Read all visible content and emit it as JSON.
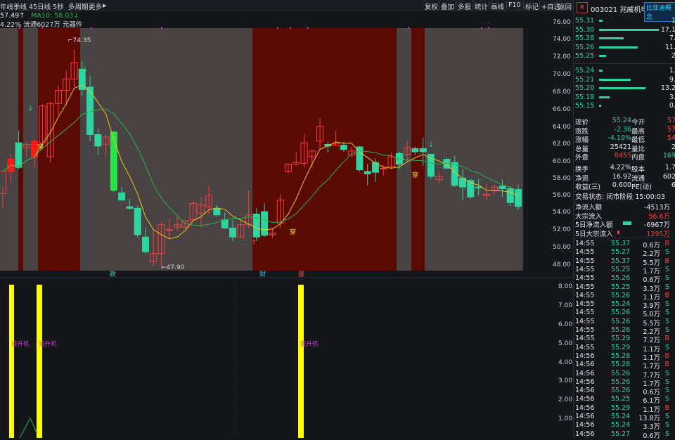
{
  "toolbar": {
    "left_items": [
      "年线",
      "季线",
      "45日线",
      "5秒",
      "多周期",
      "更多"
    ],
    "right_items": [
      "复权",
      "叠加",
      "多股",
      "统计",
      "画线",
      "F10",
      "标记",
      "+自选",
      "返回"
    ]
  },
  "indicators": {
    "ma5_label": "57.49↑",
    "ma10_label": "MA10: 58.03↓",
    "info": "4.22% 流通6027万 元器件"
  },
  "chart_labels": {
    "high_label": "74.35",
    "low_label": "47.90",
    "signal_chuan": "穿",
    "event_die": "跌",
    "event_cai": "财",
    "event_zhang": "涨",
    "sub_label": "资升机"
  },
  "price_axis": [
    "76.00",
    "74.00",
    "72.00",
    "70.00",
    "68.00",
    "66.00",
    "64.00",
    "62.00",
    "60.00",
    "58.00",
    "56.00",
    "54.00",
    "52.00",
    "50.00",
    "48.00"
  ],
  "sub_axis": [
    "8.00",
    "7.00",
    "6.00",
    "5.00",
    "4.00",
    "3.00",
    "2.00",
    "1.00"
  ],
  "stock": {
    "logo": "R",
    "code": "003021",
    "name": "兆威机电",
    "sub_tag": "比亚迪概念"
  },
  "asks": [
    {
      "price": "55.31",
      "vol": "1"
    },
    {
      "price": "55.30",
      "vol": "17.1"
    },
    {
      "price": "55.28",
      "vol": "7."
    },
    {
      "price": "55.26",
      "vol": "11."
    },
    {
      "price": "55.25",
      "vol": "2"
    }
  ],
  "bids": [
    {
      "price": "55.24",
      "vol": "1."
    },
    {
      "price": "55.21",
      "vol": "9."
    },
    {
      "price": "55.20",
      "vol": "13.2"
    },
    {
      "price": "55.18",
      "vol": "3."
    },
    {
      "price": "55.15",
      "vol": "0."
    }
  ],
  "quote": [
    {
      "l1": "现价",
      "v1": "55.24",
      "l2": "今开",
      "v2": "57"
    },
    {
      "l1": "涨跌",
      "v1": "-2.36",
      "l2": "最高",
      "v2": "57"
    },
    {
      "l1": "涨幅",
      "v1": "-4.10%",
      "l2": "最低",
      "v2": "54"
    },
    {
      "l1": "总量",
      "v1": "25421",
      "l2": "量比",
      "v2": "2"
    },
    {
      "l1": "外盘",
      "v1": "8455",
      "l2": "内盘",
      "v2": "169"
    }
  ],
  "quote2": [
    {
      "l1": "换手",
      "v1": "4.22%",
      "l2": "股本",
      "v2": "1.7"
    },
    {
      "l1": "净资",
      "v1": "16.92",
      "l2": "流通",
      "v2": "602"
    },
    {
      "l1": "收益(三)",
      "v1": "0.600",
      "l2": "PE(动)",
      "v2": "6"
    }
  ],
  "trade_state": "交易状态: 闭市阶段 15:00:03",
  "flows": [
    {
      "label": "净流入额",
      "value": "-4513万"
    },
    {
      "label": "大宗流入",
      "value": "56.6万"
    },
    {
      "label": "5日净流入额",
      "value": "-6967万"
    },
    {
      "label": "5日大宗流入",
      "value": "1295万"
    }
  ],
  "ticks": [
    {
      "t": "14:55",
      "p": "55.37",
      "v": "0.6万",
      "s": "B"
    },
    {
      "t": "14:55",
      "p": "55.27",
      "v": "2.2万",
      "s": "S"
    },
    {
      "t": "14:55",
      "p": "55.37",
      "v": "5.5万",
      "s": "B"
    },
    {
      "t": "14:55",
      "p": "55.25",
      "v": "1.7万",
      "s": "S"
    },
    {
      "t": "14:55",
      "p": "55.26",
      "v": "0.6万",
      "s": "S"
    },
    {
      "t": "14:55",
      "p": "55.25",
      "v": "3.3万",
      "s": "S"
    },
    {
      "t": "14:55",
      "p": "55.26",
      "v": "1.1万",
      "s": "B"
    },
    {
      "t": "14:55",
      "p": "55.24",
      "v": "3.9万",
      "s": "S"
    },
    {
      "t": "14:55",
      "p": "55.26",
      "v": "5.0万",
      "s": "S"
    },
    {
      "t": "14:55",
      "p": "55.26",
      "v": "5.5万",
      "s": "S"
    },
    {
      "t": "14:55",
      "p": "55.26",
      "v": "2.2万",
      "s": "S"
    },
    {
      "t": "14:55",
      "p": "55.29",
      "v": "7.2万",
      "s": "B"
    },
    {
      "t": "14:55",
      "p": "55.29",
      "v": "1.1万",
      "s": "S"
    },
    {
      "t": "14:56",
      "p": "55.28",
      "v": "1.1万",
      "s": "B"
    },
    {
      "t": "14:56",
      "p": "55.28",
      "v": "1.7万",
      "s": "B"
    },
    {
      "t": "14:56",
      "p": "55.26",
      "v": "7.7万",
      "s": "S"
    },
    {
      "t": "14:56",
      "p": "55.26",
      "v": "1.7万",
      "s": "S"
    },
    {
      "t": "14:56",
      "p": "55.26",
      "v": "0.6万",
      "s": "S"
    },
    {
      "t": "14:56",
      "p": "55.25",
      "v": "6.1万",
      "s": "S"
    },
    {
      "t": "14:56",
      "p": "55.29",
      "v": "1.1万",
      "s": "B"
    },
    {
      "t": "14:56",
      "p": "55.24",
      "v": "13.8万",
      "s": "S"
    },
    {
      "t": "14:56",
      "p": "55.24",
      "v": "3.3万",
      "s": "S"
    },
    {
      "t": "14:56",
      "p": "55.27",
      "v": "0.6万",
      "s": "S"
    }
  ],
  "candles": [
    {
      "o": 56.8,
      "h": 57.6,
      "l": 55.0,
      "c": 59.5
    },
    {
      "o": 59.5,
      "h": 61.7,
      "l": 58.2,
      "c": 61.0
    },
    {
      "o": 63.0,
      "h": 64.5,
      "l": 59.8,
      "c": 60.0
    },
    {
      "o": 62.4,
      "h": 63.1,
      "l": 61.4,
      "c": 62.8
    },
    {
      "o": 61.2,
      "h": 63.4,
      "l": 60.0,
      "c": 63.2
    },
    {
      "o": 63.0,
      "h": 67.7,
      "l": 62.2,
      "c": 67.5
    },
    {
      "o": 61.3,
      "h": 68.0,
      "l": 60.6,
      "c": 67.8
    },
    {
      "o": 67.8,
      "h": 70.0,
      "l": 66.4,
      "c": 69.4
    },
    {
      "o": 69.4,
      "h": 71.8,
      "l": 67.6,
      "c": 70.8
    },
    {
      "o": 70.8,
      "h": 74.35,
      "l": 69.8,
      "c": 72.8
    },
    {
      "o": 72.0,
      "h": 73.0,
      "l": 68.7,
      "c": 69.5
    },
    {
      "o": 69.8,
      "h": 71.2,
      "l": 63.2,
      "c": 64.0
    },
    {
      "o": 64.0,
      "h": 64.8,
      "l": 61.5,
      "c": 62.6
    },
    {
      "o": 62.8,
      "h": 64.0,
      "l": 61.5,
      "c": 63.7
    },
    {
      "o": 64.3,
      "h": 64.5,
      "l": 57.0,
      "c": 57.2
    },
    {
      "o": 56.9,
      "h": 57.6,
      "l": 56.0,
      "c": 56.0
    },
    {
      "o": 55.2,
      "h": 56.2,
      "l": 54.8,
      "c": 55.0
    },
    {
      "o": 55.0,
      "h": 55.3,
      "l": 51.5,
      "c": 51.8
    },
    {
      "o": 51.5,
      "h": 52.7,
      "l": 49.5,
      "c": 49.7
    },
    {
      "o": 48.5,
      "h": 52.4,
      "l": 47.9,
      "c": 49.5
    },
    {
      "o": 49.5,
      "h": 53.4,
      "l": 48.0,
      "c": 53.0
    },
    {
      "o": 52.4,
      "h": 53.7,
      "l": 51.3,
      "c": 52.4
    },
    {
      "o": 52.7,
      "h": 54.2,
      "l": 52.2,
      "c": 53.0
    },
    {
      "o": 52.7,
      "h": 53.6,
      "l": 52.4,
      "c": 53.5
    },
    {
      "o": 53.6,
      "h": 56.0,
      "l": 53.4,
      "c": 55.6
    },
    {
      "o": 54.4,
      "h": 56.4,
      "l": 52.6,
      "c": 55.4
    },
    {
      "o": 55.2,
      "h": 57.8,
      "l": 54.2,
      "c": 56.6
    },
    {
      "o": 55.0,
      "h": 55.4,
      "l": 54.0,
      "c": 54.2
    },
    {
      "o": 53.6,
      "h": 54.5,
      "l": 52.5,
      "c": 52.6
    },
    {
      "o": 52.6,
      "h": 53.6,
      "l": 51.0,
      "c": 51.5
    },
    {
      "o": 51.5,
      "h": 53.5,
      "l": 51.4,
      "c": 53.0
    },
    {
      "o": 53.0,
      "h": 57.2,
      "l": 52.6,
      "c": 54.2
    },
    {
      "o": 54.3,
      "h": 55.0,
      "l": 51.0,
      "c": 51.5
    },
    {
      "o": 54.6,
      "h": 55.6,
      "l": 51.5,
      "c": 51.7
    },
    {
      "o": 51.8,
      "h": 52.6,
      "l": 51.4,
      "c": 52.0
    },
    {
      "o": 53.2,
      "h": 56.7,
      "l": 52.6,
      "c": 56.0
    },
    {
      "o": 59.5,
      "h": 60.5,
      "l": 59.3,
      "c": 60.4
    },
    {
      "o": 60.4,
      "h": 61.8,
      "l": 60.2,
      "c": 60.6
    },
    {
      "o": 60.5,
      "h": 64.1,
      "l": 60.0,
      "c": 63.0
    },
    {
      "o": 61.3,
      "h": 62.2,
      "l": 60.0,
      "c": 62.0
    },
    {
      "o": 63.2,
      "h": 66.0,
      "l": 62.2,
      "c": 65.0
    },
    {
      "o": 62.8,
      "h": 63.1,
      "l": 61.8,
      "c": 62.6
    },
    {
      "o": 62.7,
      "h": 64.4,
      "l": 62.6,
      "c": 62.9
    },
    {
      "o": 62.7,
      "h": 63.1,
      "l": 61.9,
      "c": 62.2
    },
    {
      "o": 61.5,
      "h": 62.5,
      "l": 61.2,
      "c": 62.0
    },
    {
      "o": 62.5,
      "h": 62.6,
      "l": 59.5,
      "c": 59.7
    },
    {
      "o": 59.5,
      "h": 60.4,
      "l": 57.8,
      "c": 59.2
    },
    {
      "o": 60.6,
      "h": 61.1,
      "l": 58.2,
      "c": 59.4
    },
    {
      "o": 59.9,
      "h": 60.3,
      "l": 59.0,
      "c": 59.9
    },
    {
      "o": 60.1,
      "h": 61.8,
      "l": 59.8,
      "c": 61.3
    },
    {
      "o": 61.7,
      "h": 61.9,
      "l": 59.8,
      "c": 60.4
    },
    {
      "o": 61.6,
      "h": 63.2,
      "l": 60.6,
      "c": 62.4
    },
    {
      "o": 62.3,
      "h": 62.5,
      "l": 61.5,
      "c": 61.9
    },
    {
      "o": 62.3,
      "h": 63.6,
      "l": 60.2,
      "c": 61.9
    },
    {
      "o": 61.6,
      "h": 61.6,
      "l": 58.6,
      "c": 58.9
    },
    {
      "o": 58.5,
      "h": 59.5,
      "l": 58.0,
      "c": 58.9
    },
    {
      "o": 61.0,
      "h": 61.3,
      "l": 59.7,
      "c": 59.9
    },
    {
      "o": 60.6,
      "h": 61.4,
      "l": 57.6,
      "c": 57.8
    },
    {
      "o": 58.7,
      "h": 59.8,
      "l": 56.0,
      "c": 57.6
    },
    {
      "o": 58.4,
      "h": 58.6,
      "l": 56.2,
      "c": 56.4
    },
    {
      "o": 57.6,
      "h": 58.6,
      "l": 56.6,
      "c": 57.5
    },
    {
      "o": 56.6,
      "h": 58.0,
      "l": 56.0,
      "c": 56.7
    },
    {
      "o": 57.2,
      "h": 57.9,
      "l": 56.7,
      "c": 57.6
    },
    {
      "o": 57.7,
      "h": 58.5,
      "l": 56.4,
      "c": 57.4
    },
    {
      "o": 57.4,
      "h": 57.7,
      "l": 55.3,
      "c": 55.7
    },
    {
      "o": 57.3,
      "h": 57.9,
      "l": 54.8,
      "c": 55.24
    }
  ],
  "colors": {
    "up": "#ff3b3b",
    "down": "#2fd4a0",
    "shade_dark": "#5b0a03",
    "shade_light": "#4a4344",
    "ma5": "#e8c524",
    "ma10": "#28b24a"
  }
}
